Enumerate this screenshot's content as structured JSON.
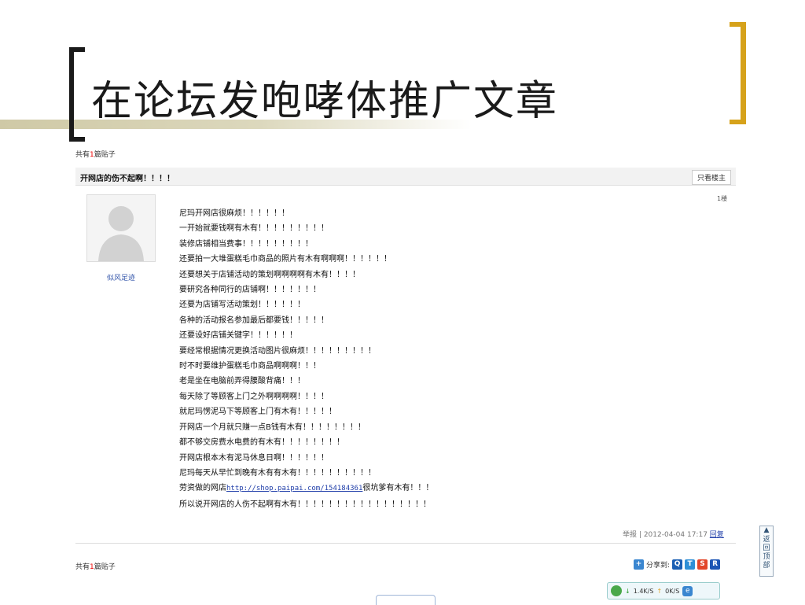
{
  "slide": {
    "title": "在论坛发咆哮体推广文章"
  },
  "forum": {
    "count_prefix": "共有",
    "count_number": "1",
    "count_suffix": "篇贴子",
    "topic_title": "开网店的伤不起啊！！！！",
    "only_op_label": "只看楼主",
    "floor_label": "1楼",
    "username": "似风足迹",
    "post_lines": [
      "尼玛开网店很麻烦！！！！！！",
      "一开始就要钱啊有木有！！！！！！！！！",
      "装修店铺相当费事！！！！！！！！！",
      "还要拍一大堆蛋糕毛巾商品的照片有木有啊啊啊！！！！！！",
      "还要想关于店铺活动的策划啊啊啊啊有木有！！！！",
      "要研究各种同行的店铺啊！！！！！！！",
      "还要为店铺写活动策划！！！！！！",
      "各种的活动报名参加最后都要钱！！！！！",
      "还要设好店铺关键字！！！！！！",
      "要经常根据情况更换活动图片很麻烦！！！！！！！！！",
      "时不时要维护蛋糕毛巾商品啊啊啊！！！",
      "老是坐在电脑前弄得腰酸背痛！！！",
      "每天除了等顾客上门之外啊啊啊啊！！！！",
      "就尼玛愣泥马下等顾客上门有木有！！！！！",
      "开网店一个月就只赚一点B钱有木有！！！！！！！！",
      "都不够交房费水电费的有木有！！！！！！！！",
      "开网店根本木有泥马休息日啊！！！！！！",
      "尼玛每天从早忙到晚有木有有木有！！！！！！！！！！"
    ],
    "link_line": {
      "before": "劳资做的网店",
      "url": "http://shop.paipai.com/154184361",
      "after": "很坑爹有木有！！！"
    },
    "last_line": "所以说开网店的人伤不起啊有木有！！！！！！！！！！！！！！！！！",
    "meta": {
      "report": "举报",
      "separator": "|",
      "datetime": "2012-04-04 17:17",
      "reply": "回复"
    },
    "share_label": "分享到:",
    "back_to_top": "返回顶部"
  },
  "speed_widget": {
    "down": "1.4K/S",
    "up": "0K/S"
  },
  "colors": {
    "accent": "#d6a21b",
    "link": "#2240aa",
    "count_highlight": "#e00000"
  }
}
